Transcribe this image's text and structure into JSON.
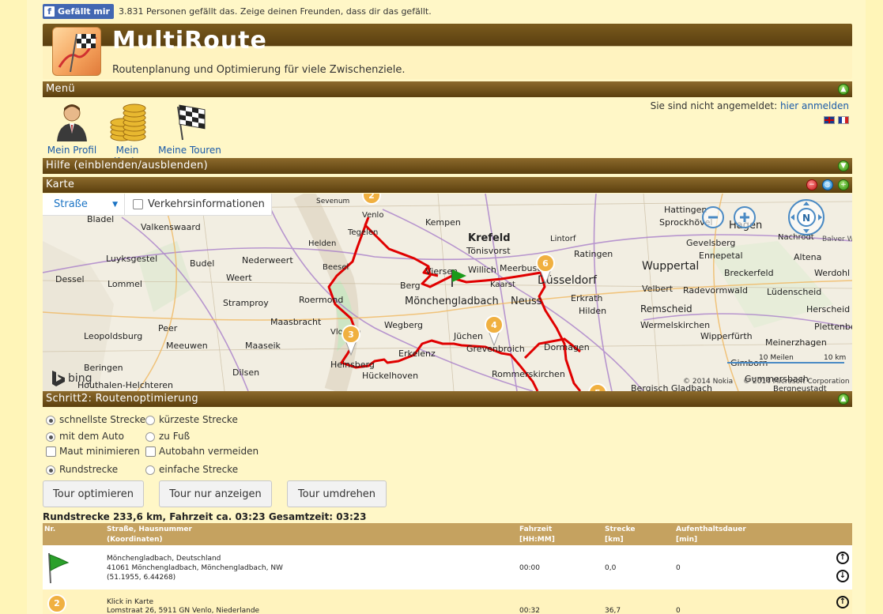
{
  "facebook": {
    "button_label": "Gefällt mir",
    "text": "3.831 Personen gefällt das. Zeige deinen Freunden, dass dir das gefällt."
  },
  "header": {
    "title": "MultiRoute",
    "subtitle": "Routenplanung und Optimierung für viele Zwischenziele."
  },
  "sections": {
    "menu": "Menü",
    "help": "Hilfe (einblenden/ausblenden)",
    "map": "Karte",
    "step2": "Schritt2: Routenoptimierung"
  },
  "menu": {
    "items": [
      {
        "label": "Mein Profil",
        "icon": "user-icon"
      },
      {
        "label": "Mein Konto",
        "icon": "coins-icon"
      },
      {
        "label": "Meine Touren",
        "icon": "checkered-flag-icon"
      }
    ],
    "login_text": "Sie sind nicht angemeldet:",
    "login_link": "hier anmelden"
  },
  "map": {
    "style_select": "Straße",
    "traffic_label": "Verkehrsinformationen",
    "provider": "bing",
    "copyright1": "© 2014 Nokia",
    "copyright2": "© 2014 Microsoft Corporation",
    "scale_miles": "10 Meilen",
    "scale_km": "10 km",
    "compass": "N",
    "places": [
      "Venlo",
      "Sevenum",
      "Bladel",
      "Valkenswaard",
      "Helden",
      "Tegelen",
      "Kempen",
      "Krefeld",
      "Lintorf",
      "Hattingen",
      "Sprockhövel",
      "Hagen",
      "Nachrodt",
      "Balver Wald",
      "Luyksgestel",
      "Budel",
      "Nederweert",
      "Beesel",
      "Tönisvorst",
      "Ratingen",
      "Wuppertal",
      "Gevelsberg",
      "Ennepetal",
      "Altena",
      "Dessel",
      "Lommel",
      "Weert",
      "Roermond",
      "Viersen",
      "Willich",
      "Meerbusch",
      "Düsseldorf",
      "Breckerfeld",
      "Werdohl",
      "Stramproy",
      "Mönchengladbach",
      "Neuss",
      "Erkrath",
      "Velbert",
      "Radevormwald",
      "Lüdenscheid",
      "Herscheid",
      "Peer",
      "Maasbracht",
      "Wegberg",
      "Hilden",
      "Remscheid",
      "Leopoldsburg",
      "Vlodrop",
      "Jüchen",
      "Wermelskirchen",
      "Plettenberg",
      "Meeuwen",
      "Maaseik",
      "Erkelenz",
      "Grevenbroich",
      "Dormagen",
      "Wipperfürth",
      "Meinerzhagen",
      "Beringen",
      "Dilsen",
      "Heinsberg",
      "Rommerskirchen",
      "Gimborn",
      "Houthalen-Helchteren",
      "Hückelhoven",
      "Bergisch Gladbach",
      "Gummersbach",
      "Bergneustadt",
      "Kaarst",
      "Berg"
    ],
    "markers": [
      "2",
      "3",
      "4",
      "6",
      "5"
    ]
  },
  "options": {
    "fastest": "schnellste Strecke",
    "shortest": "kürzeste Strecke",
    "car": "mit dem Auto",
    "foot": "zu Fuß",
    "toll": "Maut minimieren",
    "highway": "Autobahn vermeiden",
    "round": "Rundstrecke",
    "simple": "einfache Strecke"
  },
  "buttons": {
    "optimize": "Tour optimieren",
    "show": "Tour nur anzeigen",
    "reverse": "Tour umdrehen"
  },
  "summary": "Rundstrecke 233,6 km, Fahrzeit ca. 03:23 Gesamtzeit: 03:23",
  "table": {
    "headers": {
      "nr": "Nr.",
      "street1": "Straße, Hausnummer",
      "street2": "(Koordinaten)",
      "time1": "Fahrzeit",
      "time2": "[HH:MM]",
      "dist1": "Strecke",
      "dist2": "[km]",
      "stay1": "Aufenthaltsdauer",
      "stay2": "[min]"
    },
    "rows": [
      {
        "nr": "",
        "line1": "Mönchengladbach, Deutschland",
        "line2": "41061 Mönchengladbach, Mönchengladbach, NW",
        "line3": "(51.1955, 6.44268)",
        "time": "00:00",
        "dist": "0,0",
        "stay": "0"
      },
      {
        "nr": "2",
        "line1": "Klick in Karte",
        "line2": "Lomstraat 26, 5911 GN Venlo, Niederlande",
        "line3": "",
        "time": "00:32",
        "dist": "36,7",
        "stay": "0"
      }
    ]
  },
  "colors": {
    "route": "#e00000",
    "bar_dark": "#5b3f0e",
    "link": "#1a5aa8",
    "marker": "#f0b040"
  }
}
